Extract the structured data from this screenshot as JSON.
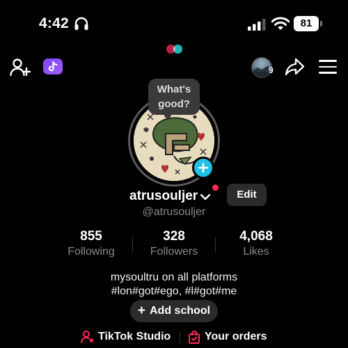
{
  "status_bar": {
    "time": "4:42",
    "battery": "81"
  },
  "top_nav": {
    "story_count": "9"
  },
  "profile": {
    "note": {
      "line1": "What's",
      "line2": "good?"
    },
    "username": "atrusouljer",
    "handle": "@atrusouljer",
    "edit_label": "Edit"
  },
  "stats": [
    {
      "value": "855",
      "label": "Following"
    },
    {
      "value": "328",
      "label": "Followers"
    },
    {
      "value": "4,068",
      "label": "Likes"
    }
  ],
  "bio": {
    "line1": "mysoultru on all platforms",
    "line2": "#lon#got#ego, #l#got#me"
  },
  "add_school": {
    "plus": "+",
    "label": "Add school"
  },
  "links": {
    "studio": "TikTok Studio",
    "orders": "Your orders"
  },
  "icons": {
    "add_user": "add-user-icon",
    "tiktok": "tiktok-logo-icon",
    "share": "share-icon",
    "menu": "menu-icon",
    "chevron": "chevron-down-icon",
    "studio": "studio-icon",
    "orders": "shopping-bag-icon"
  },
  "colors": {
    "background": "#000000",
    "accent_red": "#fe2c55",
    "accent_cyan": "#20c0e8",
    "tiktok_purple": "#8c4dff",
    "secondary_text": "#8a8a8a"
  }
}
